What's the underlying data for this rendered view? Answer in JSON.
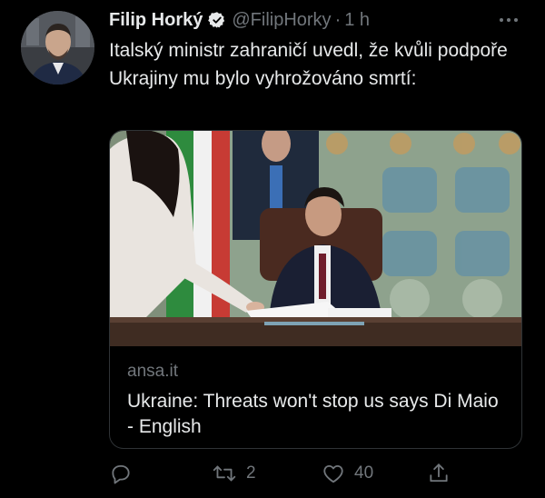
{
  "tweet": {
    "author": {
      "display_name": "Filip Horký",
      "handle": "@FilipHorky",
      "verified": true
    },
    "separator": "·",
    "time": "1 h",
    "text": "Italský ministr zahraničí uvedl, že kvůli podpoře Ukrajiny mu bylo vyhrožováno smrtí:",
    "card": {
      "domain": "ansa.it",
      "title": "Ukraine: Threats won't stop us says Di Maio - English"
    },
    "actions": {
      "reply_count": "",
      "retweet_count": "2",
      "like_count": "40"
    }
  },
  "colors": {
    "background": "#000000",
    "text_primary": "#e7e9ea",
    "text_secondary": "#71767b",
    "verified_badge": "#e7e9ea",
    "card_border": "#2f3336"
  },
  "icons": {
    "more": "more-horizontal-icon",
    "verified": "verified-badge-icon",
    "reply": "reply-icon",
    "retweet": "retweet-icon",
    "like": "heart-icon",
    "share": "share-icon"
  }
}
